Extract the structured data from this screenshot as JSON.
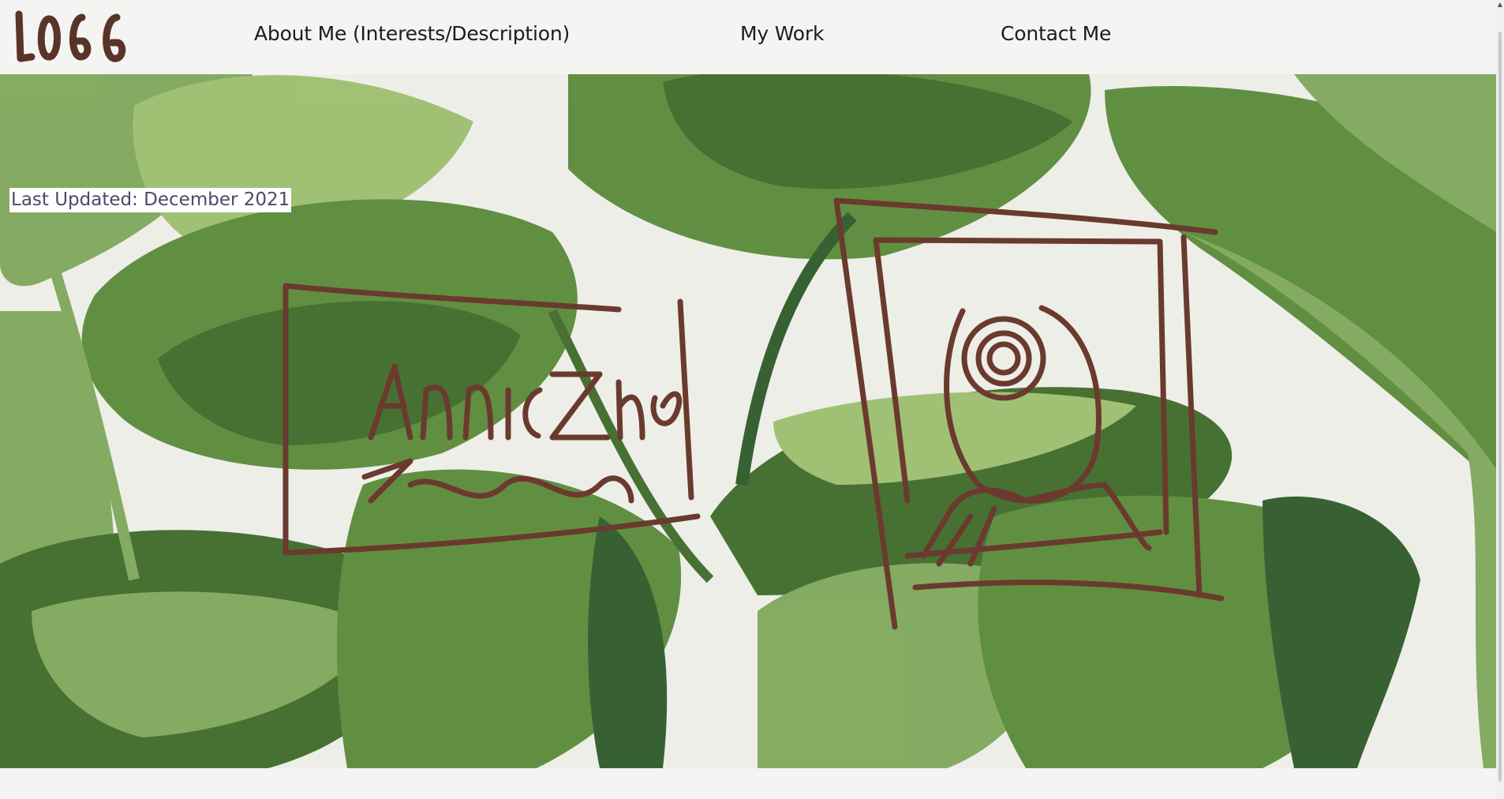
{
  "nav": {
    "logo_text": "LOGG",
    "links": [
      {
        "label": "About Me (Interests/Description)"
      },
      {
        "label": "My Work"
      },
      {
        "label": "Contact Me"
      }
    ]
  },
  "hero": {
    "last_updated": "Last Updated: December 2021",
    "name_sketch_text": "Annie Zhou",
    "sketch_color": "#6b3a2e",
    "leaf_colors": [
      "#3f6b2a",
      "#5a8a3a",
      "#7fa85a",
      "#2f5a2a",
      "#9cbf6e"
    ]
  }
}
